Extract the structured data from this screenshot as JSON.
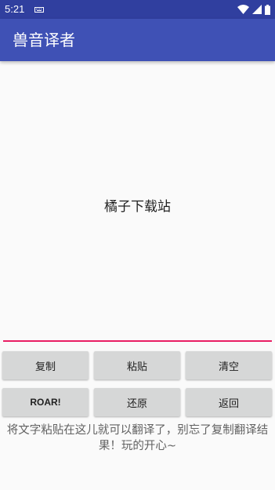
{
  "status_bar": {
    "time": "5:21",
    "icons": [
      "keyboard-icon",
      "wifi-icon",
      "signal-icon",
      "battery-icon"
    ]
  },
  "app_bar": {
    "title": "兽音译者"
  },
  "text_area": {
    "value": "橘子下载站"
  },
  "buttons": {
    "copy": "复制",
    "paste": "粘贴",
    "clear": "清空",
    "roar": "ROAR!",
    "restore": "还原",
    "back": "返回"
  },
  "hint": "将文字粘贴在这儿就可以翻译了，别忘了复制翻译结果！玩的开心~",
  "colors": {
    "status_bar": "#303f9f",
    "app_bar": "#3f51b5",
    "accent": "#e91e63",
    "button": "#d6d7d7"
  }
}
